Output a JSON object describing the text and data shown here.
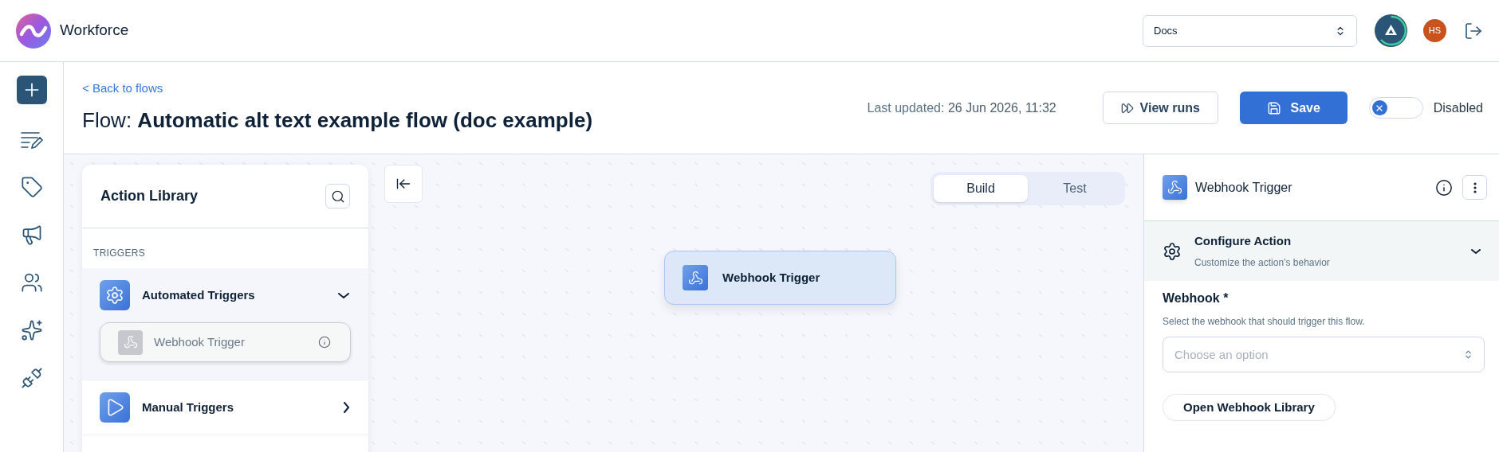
{
  "header": {
    "brand": "Workforce",
    "workspace_select": {
      "value": "Docs"
    },
    "avatar_initials": "HS"
  },
  "flow": {
    "back_link": "< Back to flows",
    "title_prefix": "Flow:",
    "title": "Automatic alt text example flow (doc example)",
    "last_updated_label": "Last updated:",
    "last_updated_value": "26 Jun 2026, 11:32",
    "view_runs_button": "View runs",
    "save_button": "Save",
    "status_toggle": {
      "on": false,
      "label": "Disabled"
    }
  },
  "action_library": {
    "title": "Action Library",
    "section": "TRIGGERS",
    "groups": [
      {
        "kind": "automated",
        "label": "Automated Triggers",
        "expanded": true,
        "items": [
          {
            "label": "Webhook Trigger"
          }
        ]
      },
      {
        "kind": "manual",
        "label": "Manual Triggers",
        "expanded": false
      }
    ]
  },
  "view_tabs": [
    {
      "label": "Build",
      "selected": true
    },
    {
      "label": "Test",
      "selected": false
    }
  ],
  "canvas_node": {
    "label": "Webhook Trigger"
  },
  "details_panel": {
    "title": "Webhook Trigger",
    "section": {
      "title": "Configure Action",
      "subtitle": "Customize the action’s behavior",
      "expanded": true
    },
    "field": {
      "label": "Webhook *",
      "help": "Select the webhook that should trigger this flow.",
      "placeholder": "Choose an option"
    },
    "library_button": "Open Webhook Library"
  }
}
